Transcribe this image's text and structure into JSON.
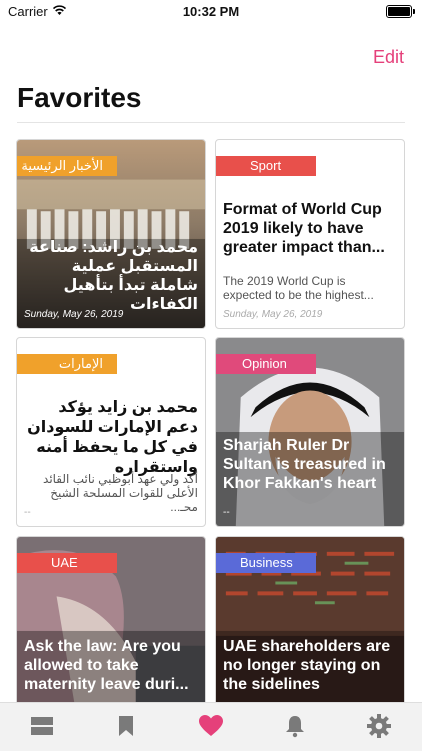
{
  "status": {
    "carrier": "Carrier",
    "time": "10:32 PM"
  },
  "header": {
    "edit_label": "Edit",
    "title": "Favorites"
  },
  "cards": [
    {
      "category": "الأخبار الرئيسية",
      "headline": "محمد بن راشد: صناعة المستقبل عملية شاملة تبدأ بتأهيل الكفاءات",
      "date": "Sunday, May 26, 2019",
      "tag_color": "#f0a12b"
    },
    {
      "category": "Sport",
      "headline": "Format of World Cup 2019 likely to have greater impact than...",
      "excerpt": "The 2019 World Cup is expected to be the highest...",
      "date": "Sunday, May 26, 2019",
      "tag_color": "#e8504b"
    },
    {
      "category": "الإمارات",
      "headline": "محمد بن زايد يؤكد دعم الإمارات للسودان في كل ما يحفظ أمنه واستقراره",
      "excerpt": "أكد ولي عهد أبوظبي نائب القائد الأعلى للقوات المسلحة الشيخ محـ...",
      "date": "--",
      "tag_color": "#f0a12b"
    },
    {
      "category": "Opinion",
      "headline": "Sharjah Ruler Dr Sultan is treasured in Khor Fakkan's heart",
      "date": "--",
      "tag_color": "#e04a7b"
    },
    {
      "category": "UAE",
      "headline": "Ask the law: Are you allowed to take maternity leave duri...",
      "tag_color": "#e8504b"
    },
    {
      "category": "Business",
      "headline": "UAE shareholders are no longer staying on the sidelines",
      "tag_color": "#5a6ad8"
    }
  ],
  "tabbar": {
    "items": [
      {
        "icon": "news-feed-icon"
      },
      {
        "icon": "bookmark-icon"
      },
      {
        "icon": "heart-icon",
        "active": true
      },
      {
        "icon": "bell-icon"
      },
      {
        "icon": "gear-icon"
      }
    ],
    "active_color": "#e5407a",
    "inactive_color": "#7a7a7a"
  }
}
